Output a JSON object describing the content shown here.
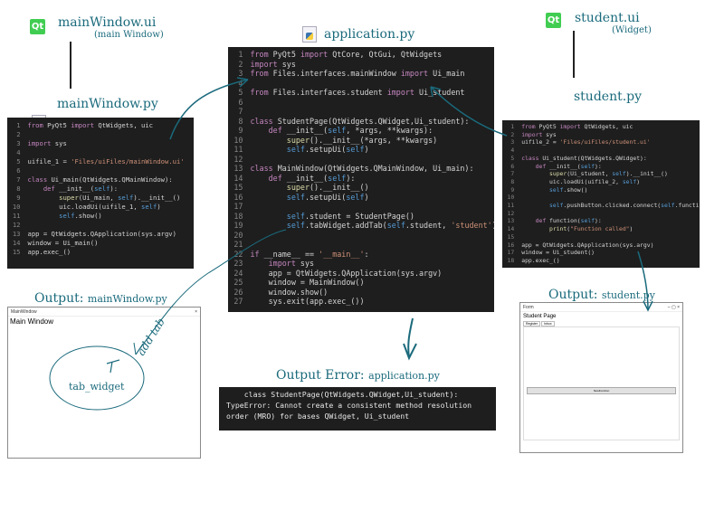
{
  "labels": {
    "mainwindow_ui": "mainWindow.ui",
    "mainwindow_ui_sub": "(main Window)",
    "application_py": "application.py",
    "student_ui": "student.ui",
    "student_ui_sub": "(Widget)",
    "mainwindow_py": "mainWindow.py",
    "student_py": "student.py",
    "output_main_prefix": "Output: ",
    "output_main_name": "mainWindow.py",
    "output_student_prefix": "Output: ",
    "output_student_name": "student.py",
    "output_error_prefix": "Output Error: ",
    "output_error_name": "application.py",
    "qt_icon_text": "Qt",
    "handwriting": "add tab",
    "circle_text": "tab_widget"
  },
  "icons": {
    "qt": "qt-designer-icon",
    "py": "python-file-icon"
  },
  "colors": {
    "annotation": "#1a6a7c",
    "editor_bg": "#1e1e1e"
  },
  "mainwindow_code": [
    {
      "n": "1",
      "t": "from PyQt5 import QtWidgets, uic"
    },
    {
      "n": "2",
      "t": ""
    },
    {
      "n": "3",
      "t": "import sys"
    },
    {
      "n": "4",
      "t": ""
    },
    {
      "n": "5",
      "t": "uifile_1 = 'Files/uiFiles/mainWindow.ui'"
    },
    {
      "n": "6",
      "t": ""
    },
    {
      "n": "7",
      "t": "class Ui_main(QtWidgets.QMainWindow):"
    },
    {
      "n": "8",
      "t": "    def __init__(self):"
    },
    {
      "n": "9",
      "t": "        super(Ui_main, self).__init__()"
    },
    {
      "n": "10",
      "t": "        uic.loadUi(uifile_1, self)"
    },
    {
      "n": "11",
      "t": "        self.show()"
    },
    {
      "n": "12",
      "t": ""
    },
    {
      "n": "13",
      "t": "app = QtWidgets.QApplication(sys.argv)"
    },
    {
      "n": "14",
      "t": "window = Ui_main()"
    },
    {
      "n": "15",
      "t": "app.exec_()"
    }
  ],
  "application_code": [
    {
      "n": "1",
      "t": "from PyQt5 import QtCore, QtGui, QtWidgets"
    },
    {
      "n": "2",
      "t": "import sys"
    },
    {
      "n": "3",
      "t": "from Files.interfaces.mainWindow import Ui_main"
    },
    {
      "n": "4",
      "t": ""
    },
    {
      "n": "5",
      "t": "from Files.interfaces.student import Ui_student"
    },
    {
      "n": "6",
      "t": ""
    },
    {
      "n": "7",
      "t": ""
    },
    {
      "n": "8",
      "t": "class StudentPage(QtWidgets.QWidget,Ui_student):"
    },
    {
      "n": "9",
      "t": "    def __init__(self, *args, **kwargs):"
    },
    {
      "n": "10",
      "t": "        super().__init__(*args, **kwargs)"
    },
    {
      "n": "11",
      "t": "        self.setupUi(self)"
    },
    {
      "n": "12",
      "t": ""
    },
    {
      "n": "13",
      "t": "class MainWindow(QtWidgets.QMainWindow, Ui_main):"
    },
    {
      "n": "14",
      "t": "    def __init__(self):"
    },
    {
      "n": "15",
      "t": "        super().__init__()"
    },
    {
      "n": "16",
      "t": "        self.setupUi(self)"
    },
    {
      "n": "17",
      "t": ""
    },
    {
      "n": "18",
      "t": "        self.student = StudentPage()"
    },
    {
      "n": "19",
      "t": "        self.tabWidget.addTab(self.student, 'student')"
    },
    {
      "n": "20",
      "t": ""
    },
    {
      "n": "21",
      "t": ""
    },
    {
      "n": "22",
      "t": "if __name__ == '__main__':"
    },
    {
      "n": "23",
      "t": "    import sys"
    },
    {
      "n": "24",
      "t": "    app = QtWidgets.QApplication(sys.argv)"
    },
    {
      "n": "25",
      "t": "    window = MainWindow()"
    },
    {
      "n": "26",
      "t": "    window.show()"
    },
    {
      "n": "27",
      "t": "    sys.exit(app.exec_())"
    }
  ],
  "student_code": [
    {
      "n": "1",
      "t": "from PyQt5 import QtWidgets, uic"
    },
    {
      "n": "2",
      "t": "import sys"
    },
    {
      "n": "3",
      "t": "uifile_2 = 'Files/uiFiles/student.ui'"
    },
    {
      "n": "4",
      "t": ""
    },
    {
      "n": "5",
      "t": "class Ui_student(QtWidgets.QWidget):"
    },
    {
      "n": "6",
      "t": "    def __init__(self):"
    },
    {
      "n": "7",
      "t": "        super(Ui_student, self).__init__()"
    },
    {
      "n": "8",
      "t": "        uic.loadUi(uifile_2, self)"
    },
    {
      "n": "9",
      "t": "        self.show()"
    },
    {
      "n": "10",
      "t": ""
    },
    {
      "n": "11",
      "t": "        self.pushButton.clicked.connect(self.function)"
    },
    {
      "n": "12",
      "t": ""
    },
    {
      "n": "13",
      "t": "    def function(self):"
    },
    {
      "n": "14",
      "t": "        print(\"Function called\")"
    },
    {
      "n": "15",
      "t": ""
    },
    {
      "n": "16",
      "t": "app = QtWidgets.QApplication(sys.argv)"
    },
    {
      "n": "17",
      "t": "window = Ui_student()"
    },
    {
      "n": "18",
      "t": "app.exec_()"
    }
  ],
  "error_lines": [
    "    class StudentPage(QtWidgets.QWidget,Ui_student):",
    "TypeError: Cannot create a consistent method resolution",
    "order (MRO) for bases QWidget, Ui_student"
  ],
  "main_window_output": {
    "title": "MainWindow",
    "close": "×",
    "heading": "Main Window"
  },
  "student_window_output": {
    "title": "Form",
    "controls": "–  ▢  ×",
    "heading": "Student Page",
    "tabs": [
      "Register",
      "Inbox"
    ],
    "button": "NewFunction"
  }
}
